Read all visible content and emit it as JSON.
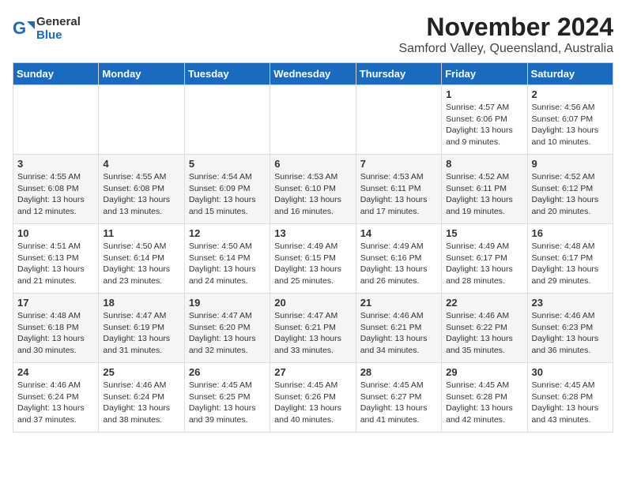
{
  "logo": {
    "general": "General",
    "blue": "Blue"
  },
  "title": "November 2024",
  "location": "Samford Valley, Queensland, Australia",
  "days_of_week": [
    "Sunday",
    "Monday",
    "Tuesday",
    "Wednesday",
    "Thursday",
    "Friday",
    "Saturday"
  ],
  "weeks": [
    [
      {
        "day": "",
        "content": ""
      },
      {
        "day": "",
        "content": ""
      },
      {
        "day": "",
        "content": ""
      },
      {
        "day": "",
        "content": ""
      },
      {
        "day": "",
        "content": ""
      },
      {
        "day": "1",
        "content": "Sunrise: 4:57 AM\nSunset: 6:06 PM\nDaylight: 13 hours and 9 minutes."
      },
      {
        "day": "2",
        "content": "Sunrise: 4:56 AM\nSunset: 6:07 PM\nDaylight: 13 hours and 10 minutes."
      }
    ],
    [
      {
        "day": "3",
        "content": "Sunrise: 4:55 AM\nSunset: 6:08 PM\nDaylight: 13 hours and 12 minutes."
      },
      {
        "day": "4",
        "content": "Sunrise: 4:55 AM\nSunset: 6:08 PM\nDaylight: 13 hours and 13 minutes."
      },
      {
        "day": "5",
        "content": "Sunrise: 4:54 AM\nSunset: 6:09 PM\nDaylight: 13 hours and 15 minutes."
      },
      {
        "day": "6",
        "content": "Sunrise: 4:53 AM\nSunset: 6:10 PM\nDaylight: 13 hours and 16 minutes."
      },
      {
        "day": "7",
        "content": "Sunrise: 4:53 AM\nSunset: 6:11 PM\nDaylight: 13 hours and 17 minutes."
      },
      {
        "day": "8",
        "content": "Sunrise: 4:52 AM\nSunset: 6:11 PM\nDaylight: 13 hours and 19 minutes."
      },
      {
        "day": "9",
        "content": "Sunrise: 4:52 AM\nSunset: 6:12 PM\nDaylight: 13 hours and 20 minutes."
      }
    ],
    [
      {
        "day": "10",
        "content": "Sunrise: 4:51 AM\nSunset: 6:13 PM\nDaylight: 13 hours and 21 minutes."
      },
      {
        "day": "11",
        "content": "Sunrise: 4:50 AM\nSunset: 6:14 PM\nDaylight: 13 hours and 23 minutes."
      },
      {
        "day": "12",
        "content": "Sunrise: 4:50 AM\nSunset: 6:14 PM\nDaylight: 13 hours and 24 minutes."
      },
      {
        "day": "13",
        "content": "Sunrise: 4:49 AM\nSunset: 6:15 PM\nDaylight: 13 hours and 25 minutes."
      },
      {
        "day": "14",
        "content": "Sunrise: 4:49 AM\nSunset: 6:16 PM\nDaylight: 13 hours and 26 minutes."
      },
      {
        "day": "15",
        "content": "Sunrise: 4:49 AM\nSunset: 6:17 PM\nDaylight: 13 hours and 28 minutes."
      },
      {
        "day": "16",
        "content": "Sunrise: 4:48 AM\nSunset: 6:17 PM\nDaylight: 13 hours and 29 minutes."
      }
    ],
    [
      {
        "day": "17",
        "content": "Sunrise: 4:48 AM\nSunset: 6:18 PM\nDaylight: 13 hours and 30 minutes."
      },
      {
        "day": "18",
        "content": "Sunrise: 4:47 AM\nSunset: 6:19 PM\nDaylight: 13 hours and 31 minutes."
      },
      {
        "day": "19",
        "content": "Sunrise: 4:47 AM\nSunset: 6:20 PM\nDaylight: 13 hours and 32 minutes."
      },
      {
        "day": "20",
        "content": "Sunrise: 4:47 AM\nSunset: 6:21 PM\nDaylight: 13 hours and 33 minutes."
      },
      {
        "day": "21",
        "content": "Sunrise: 4:46 AM\nSunset: 6:21 PM\nDaylight: 13 hours and 34 minutes."
      },
      {
        "day": "22",
        "content": "Sunrise: 4:46 AM\nSunset: 6:22 PM\nDaylight: 13 hours and 35 minutes."
      },
      {
        "day": "23",
        "content": "Sunrise: 4:46 AM\nSunset: 6:23 PM\nDaylight: 13 hours and 36 minutes."
      }
    ],
    [
      {
        "day": "24",
        "content": "Sunrise: 4:46 AM\nSunset: 6:24 PM\nDaylight: 13 hours and 37 minutes."
      },
      {
        "day": "25",
        "content": "Sunrise: 4:46 AM\nSunset: 6:24 PM\nDaylight: 13 hours and 38 minutes."
      },
      {
        "day": "26",
        "content": "Sunrise: 4:45 AM\nSunset: 6:25 PM\nDaylight: 13 hours and 39 minutes."
      },
      {
        "day": "27",
        "content": "Sunrise: 4:45 AM\nSunset: 6:26 PM\nDaylight: 13 hours and 40 minutes."
      },
      {
        "day": "28",
        "content": "Sunrise: 4:45 AM\nSunset: 6:27 PM\nDaylight: 13 hours and 41 minutes."
      },
      {
        "day": "29",
        "content": "Sunrise: 4:45 AM\nSunset: 6:28 PM\nDaylight: 13 hours and 42 minutes."
      },
      {
        "day": "30",
        "content": "Sunrise: 4:45 AM\nSunset: 6:28 PM\nDaylight: 13 hours and 43 minutes."
      }
    ]
  ]
}
